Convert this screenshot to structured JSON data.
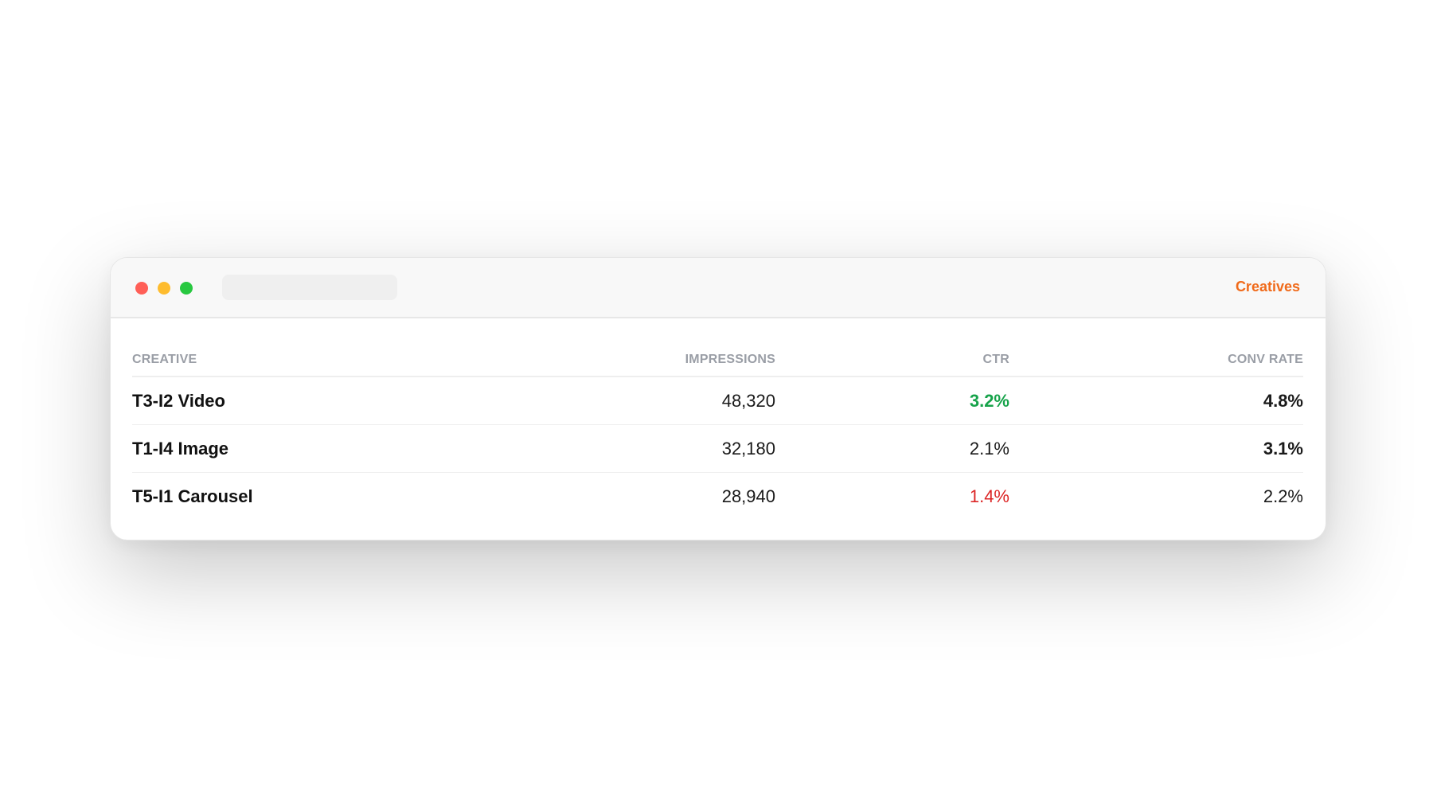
{
  "window": {
    "title": "Creatives",
    "title_color": "#f06a1a"
  },
  "table": {
    "columns": [
      "CREATIVE",
      "IMPRESSIONS",
      "CTR",
      "CONV RATE"
    ],
    "rows": [
      {
        "creative": "T3-I2 Video",
        "impressions": "48,320",
        "ctr": "3.2%",
        "ctr_status": "positive",
        "conv_rate": "4.8%",
        "conv_bold": true
      },
      {
        "creative": "T1-I4 Image",
        "impressions": "32,180",
        "ctr": "2.1%",
        "ctr_status": "neutral",
        "conv_rate": "3.1%",
        "conv_bold": true
      },
      {
        "creative": "T5-I1 Carousel",
        "impressions": "28,940",
        "ctr": "1.4%",
        "ctr_status": "negative",
        "conv_rate": "2.2%",
        "conv_bold": false
      }
    ]
  },
  "colors": {
    "positive": "#16a34a",
    "negative": "#dc2626",
    "close": "#ff5f57",
    "minimize": "#febc2e",
    "maximize": "#28c840"
  }
}
